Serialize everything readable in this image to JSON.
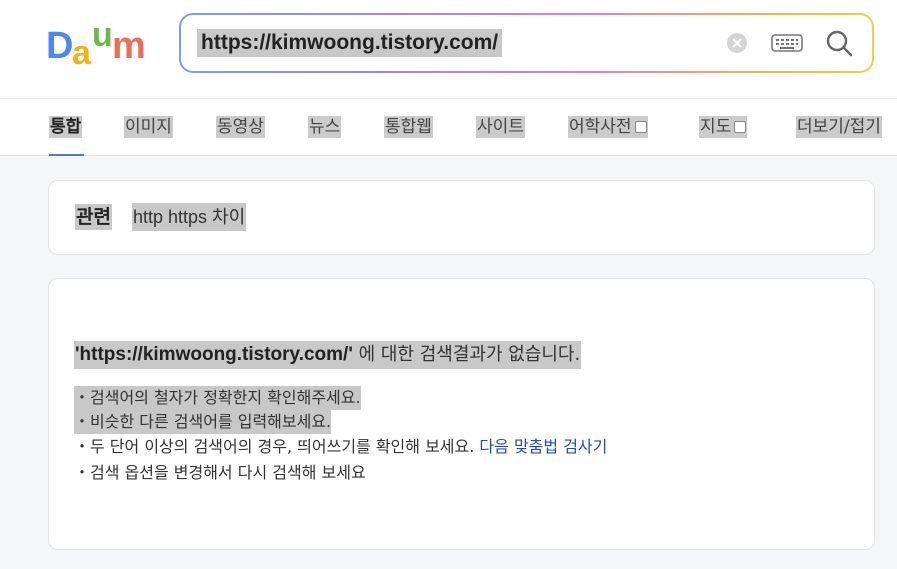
{
  "logo": {
    "text": "Daum",
    "colors": {
      "d": "#4e87f0",
      "a": "#f2b21a",
      "u": "#6ab94c",
      "m": "#ee6d5a"
    }
  },
  "search": {
    "value": "https://kimwoong.tistory.com/"
  },
  "nav": {
    "tabs": [
      {
        "label": "통합",
        "active": true
      },
      {
        "label": "이미지"
      },
      {
        "label": "동영상"
      },
      {
        "label": "뉴스"
      },
      {
        "label": "통합웹"
      },
      {
        "label": "사이트"
      },
      {
        "label": "어학사전",
        "external": true
      },
      {
        "label": "지도",
        "external": true
      },
      {
        "label": "더보기/접기"
      }
    ],
    "accent": "#4b78e8"
  },
  "related": {
    "label": "관련",
    "link": "http https 차이"
  },
  "result": {
    "query": "'https://kimwoong.tistory.com/'",
    "message": " 에 대한 검색결과가 없습니다.",
    "tips": [
      {
        "text": "・검색어의 철자가 정확한지 확인해주세요."
      },
      {
        "text": "・비슷한 다른 검색어를 입력해보세요."
      },
      {
        "text": "・두 단어 이상의 검색어의 경우, 띄어쓰기를 확인해 보세요. ",
        "link": "다음 맞춤법 검사기"
      },
      {
        "text": "・검색 옵션을 변경해서 다시 검색해 보세요"
      }
    ],
    "link_color": "#1a4fb5"
  }
}
